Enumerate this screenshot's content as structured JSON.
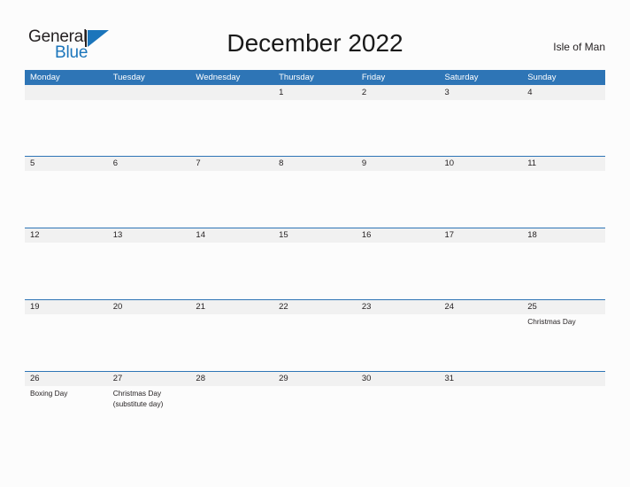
{
  "brand": {
    "name_part1": "General",
    "name_part2": "Blue",
    "flag_icon": "blue-pennant-icon"
  },
  "header": {
    "title": "December 2022",
    "location": "Isle of Man"
  },
  "colors": {
    "header_blue": "#2e75b6",
    "band_gray": "#f1f1f1",
    "page_background": "#fcfcfc",
    "logo_blue": "#1b75bb",
    "text": "#231f20"
  },
  "calendar": {
    "weekdays": [
      "Monday",
      "Tuesday",
      "Wednesday",
      "Thursday",
      "Friday",
      "Saturday",
      "Sunday"
    ],
    "weeks": [
      {
        "dates": [
          "",
          "",
          "",
          "1",
          "2",
          "3",
          "4"
        ],
        "events": [
          "",
          "",
          "",
          "",
          "",
          "",
          ""
        ]
      },
      {
        "dates": [
          "5",
          "6",
          "7",
          "8",
          "9",
          "10",
          "11"
        ],
        "events": [
          "",
          "",
          "",
          "",
          "",
          "",
          ""
        ]
      },
      {
        "dates": [
          "12",
          "13",
          "14",
          "15",
          "16",
          "17",
          "18"
        ],
        "events": [
          "",
          "",
          "",
          "",
          "",
          "",
          ""
        ]
      },
      {
        "dates": [
          "19",
          "20",
          "21",
          "22",
          "23",
          "24",
          "25"
        ],
        "events": [
          "",
          "",
          "",
          "",
          "",
          "",
          "Christmas Day"
        ]
      },
      {
        "dates": [
          "26",
          "27",
          "28",
          "29",
          "30",
          "31",
          ""
        ],
        "events": [
          "Boxing Day",
          "Christmas Day\n(substitute day)",
          "",
          "",
          "",
          "",
          ""
        ]
      }
    ]
  }
}
